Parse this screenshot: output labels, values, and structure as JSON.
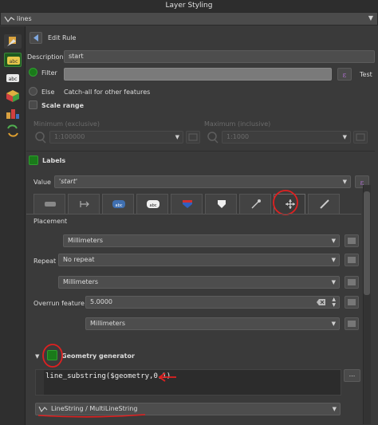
{
  "window": {
    "title": "Layer Styling"
  },
  "layer_selector": {
    "value": "lines"
  },
  "header": {
    "title": "Edit Rule"
  },
  "description": {
    "label": "Description",
    "value": "start"
  },
  "filter": {
    "label": "Filter",
    "test_label": "Test"
  },
  "else": {
    "label": "Else",
    "hint": "Catch-all for other features"
  },
  "scale_range": {
    "label": "Scale range",
    "min_label": "Minimum (exclusive)",
    "max_label": "Maximum (inclusive)",
    "min_value": "1:100000",
    "max_value": "1:1000"
  },
  "labels": {
    "title": "Labels",
    "value_label": "Value",
    "value": "'start'"
  },
  "placement": {
    "label": "Placement",
    "unit1": "Millimeters",
    "repeat_label": "Repeat",
    "repeat_value": "No repeat",
    "unit2": "Millimeters",
    "overrun_label": "Overrun feature",
    "overrun_value": "5.0000",
    "unit3": "Millimeters"
  },
  "geometry_generator": {
    "title": "Geometry generator",
    "expression": "line_substring($geometry,0,1)",
    "dots_label": "...",
    "type": "LineString / MultiLineString"
  },
  "colors": {
    "accent_green": "#1a7a1a",
    "annotation_red": "#e02020",
    "panel": "#3a3a3a"
  }
}
